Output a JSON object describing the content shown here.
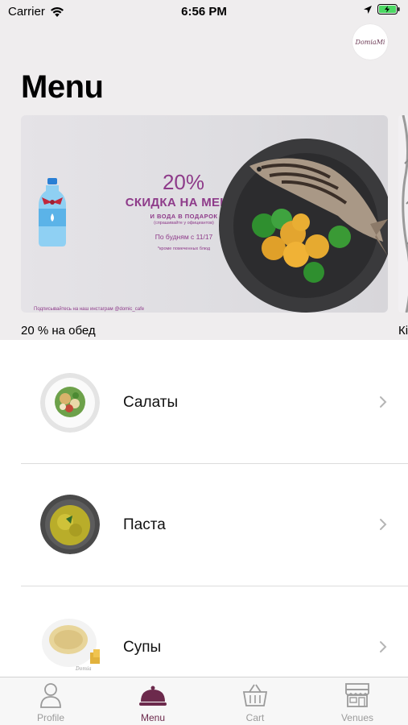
{
  "status_bar": {
    "carrier": "Carrier",
    "time": "6:56 PM"
  },
  "header": {
    "title": "Menu",
    "logo_text": "DomiaMi"
  },
  "banners": [
    {
      "caption": "20 % на обед",
      "promo": {
        "percent": "20%",
        "headline": "СКИДКА НА МЕНЮ",
        "gift": "И ВОДА В ПОДАРОК",
        "gift_note": "(спрашивайте у официантов)",
        "days": "По будням с 11/17",
        "footnote": "*кроме помеченных блюд",
        "instagram": "Подписывайтесь на наш инстаграм @domic_cafe"
      }
    },
    {
      "caption": "Кі"
    }
  ],
  "categories": [
    {
      "name": "Салаты"
    },
    {
      "name": "Паста"
    },
    {
      "name": "Супы"
    }
  ],
  "tabs": [
    {
      "label": "Profile",
      "icon": "profile-icon"
    },
    {
      "label": "Menu",
      "icon": "cloche-icon"
    },
    {
      "label": "Cart",
      "icon": "basket-icon"
    },
    {
      "label": "Venues",
      "icon": "store-icon"
    }
  ],
  "colors": {
    "accent": "#6c2a4c",
    "promo": "#8e3b8a",
    "header_bg": "#efedee",
    "tab_inactive": "#9b9b9b"
  }
}
